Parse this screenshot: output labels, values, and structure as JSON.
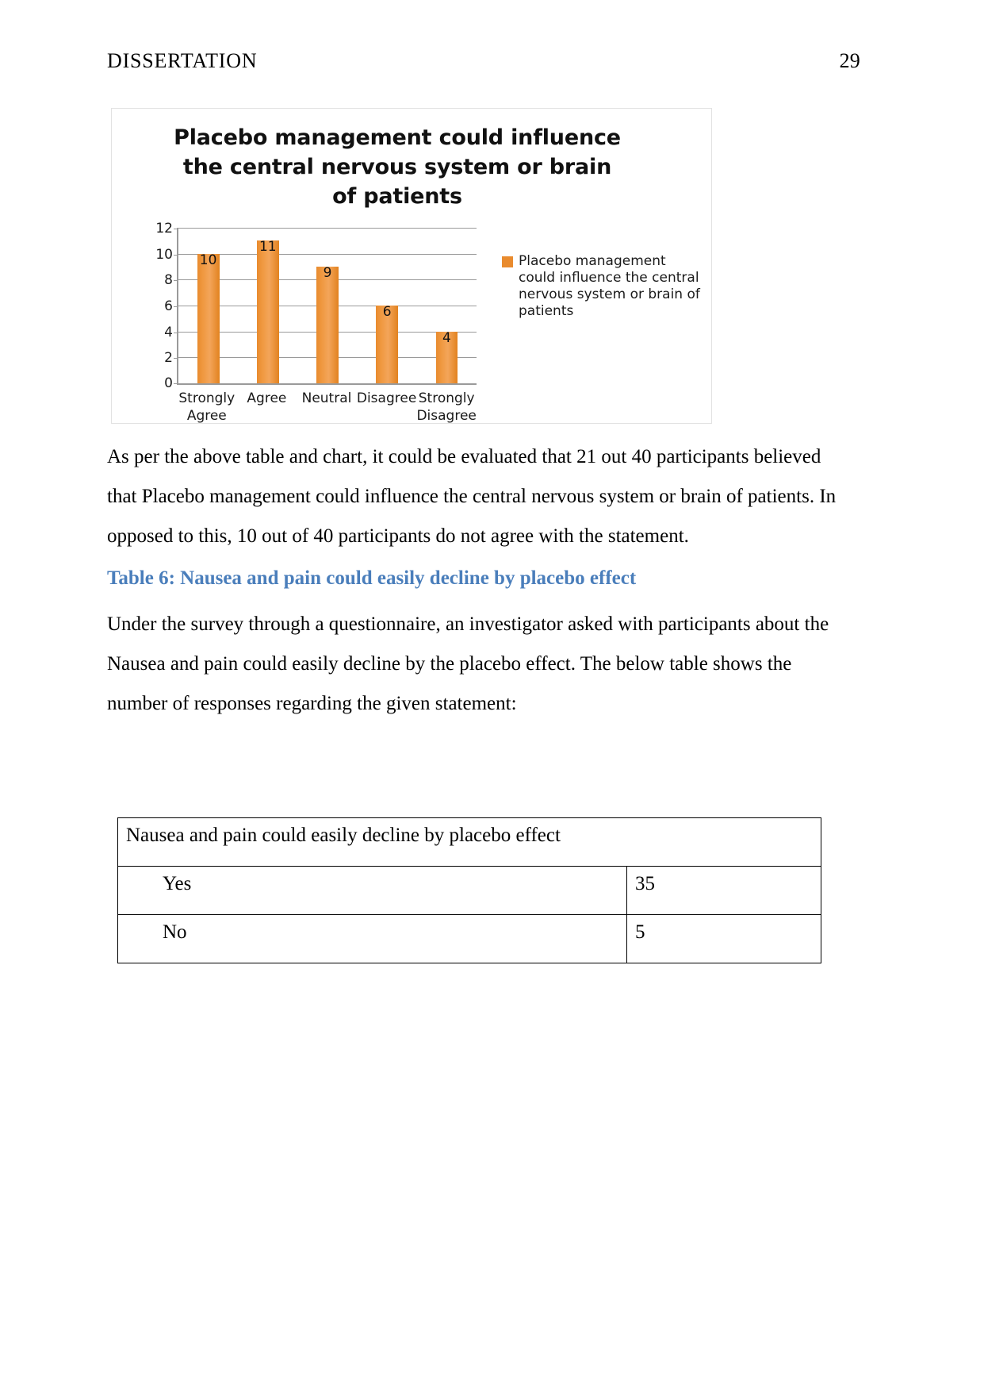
{
  "header": {
    "title": "DISSERTATION",
    "page_number": "29"
  },
  "chart_data": {
    "type": "bar",
    "title": "Placebo management could influence the central nervous system or brain of patients",
    "title_lines": [
      "Placebo management could influence",
      "the central nervous system or brain",
      "of patients"
    ],
    "categories": [
      "Strongly Agree",
      "Agree",
      "Neutral",
      "Disagree",
      "Strongly Disagree"
    ],
    "category_lines": [
      [
        "Strongly",
        "Agree"
      ],
      [
        "Agree"
      ],
      [
        "Neutral"
      ],
      [
        "Disagree"
      ],
      [
        "Strongly",
        "Disagree"
      ]
    ],
    "values": [
      10,
      11,
      9,
      6,
      4
    ],
    "value_labels": [
      "10",
      "11",
      "9",
      "6",
      "4"
    ],
    "xlabel": "",
    "ylabel": "",
    "ylim": [
      0,
      12
    ],
    "yticks": [
      0,
      2,
      4,
      6,
      8,
      10,
      12
    ],
    "ytick_labels": [
      "0",
      "2",
      "4",
      "6",
      "8",
      "10",
      "12"
    ],
    "grid": true,
    "legend_position": "right",
    "legend": [
      {
        "name": "Placebo management could influence the central nervous system or brain of patients",
        "lines": [
          "Placebo management",
          "could influence the central",
          "nervous system or brain of",
          "patients"
        ],
        "color": "#e98b2e"
      }
    ],
    "series": [
      {
        "name": "Placebo management could influence the central nervous system or brain of patients",
        "values": [
          10,
          11,
          9,
          6,
          4
        ],
        "color": "#e98b2e"
      }
    ]
  },
  "body": {
    "paragraph_1": "As per the above table and chart, it could be evaluated that 21 out 40 participants believed that Placebo management could influence the central nervous system or brain of patients. In opposed to this, 10 out of 40 participants do not agree with the statement.",
    "paragraph_1_lines": [
      "As per the above table and chart, it could be evaluated that 21 out 40 participants believed",
      "that Placebo management could influence the central nervous system or brain of patients. In",
      "opposed to this, 10 out of 40 participants do not agree with the statement."
    ],
    "heading_table_6": "Table 6: Nausea and pain could easily decline by placebo effect",
    "heading_color": "#4a7ebb",
    "paragraph_2": "Under the survey through a questionnaire, an investigator asked with participants about the Nausea and pain could easily decline by the placebo effect. The below table shows the number of responses regarding the given statement:",
    "paragraph_2_lines": [
      "Under the survey through a questionnaire, an investigator asked with participants about the",
      "Nausea and pain could easily decline by the placebo effect. The below table shows the",
      "number of responses regarding the given statement:"
    ]
  },
  "table_6": {
    "caption": "Nausea and pain could easily decline by placebo effect",
    "rows": [
      {
        "label": "Yes",
        "value": "35"
      },
      {
        "label": "No",
        "value": "5"
      }
    ]
  }
}
